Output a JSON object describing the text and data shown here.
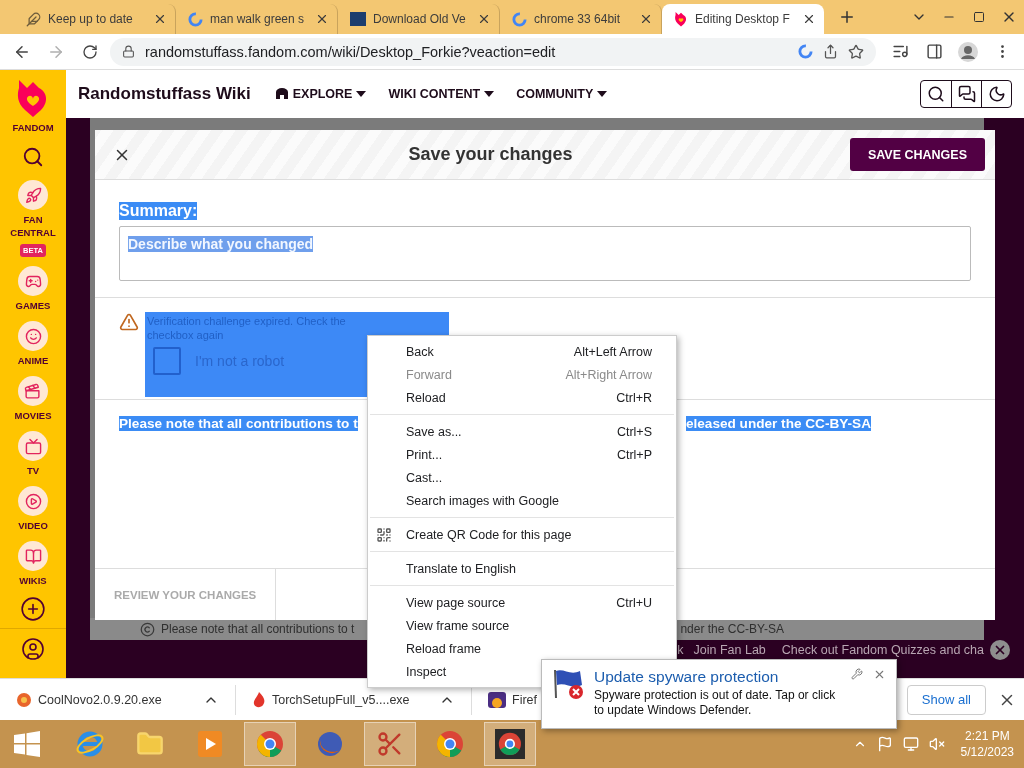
{
  "browser": {
    "tabs": [
      {
        "title": "Keep up to date",
        "kind": "feather",
        "selected": false
      },
      {
        "title": "man walk green s",
        "kind": "google",
        "selected": false
      },
      {
        "title": "Download Old Ve",
        "kind": "square",
        "selected": false
      },
      {
        "title": "chrome 33 64bit",
        "kind": "google",
        "selected": false
      },
      {
        "title": "Editing Desktop F",
        "kind": "fandom",
        "selected": true
      }
    ],
    "forward_disabled": true,
    "address": "randomstuffass.fandom.com/wiki/Desktop_Forkie?veaction=edit"
  },
  "rail": {
    "logo_label": "FANDOM",
    "items": [
      {
        "kind": "rocket",
        "label": "FAN CENTRAL",
        "badge": "BETA"
      },
      {
        "kind": "gamepad",
        "label": "GAMES"
      },
      {
        "kind": "face",
        "label": "ANIME"
      },
      {
        "kind": "clapper",
        "label": "MOVIES"
      },
      {
        "kind": "tv",
        "label": "TV"
      },
      {
        "kind": "play",
        "label": "VIDEO"
      },
      {
        "kind": "book",
        "label": "WIKIS"
      }
    ]
  },
  "wiki_nav": {
    "title": "Randomstuffass Wiki",
    "menus": [
      "EXPLORE",
      "WIKI CONTENT",
      "COMMUNITY"
    ]
  },
  "background_page": {
    "license_left": "Please note that all contributions to t",
    "license_right": "nder the CC-BY-SA",
    "footer_links": [
      "k",
      "Join Fan Lab",
      "Check out Fandom Quizzes and cha"
    ]
  },
  "dialog": {
    "title": "Save your changes",
    "save_button": "SAVE CHANGES",
    "highlighted": true,
    "summary_label": "Summary:",
    "summary_placeholder": "Describe what you changed",
    "captcha": {
      "message": "Verification challenge expired. Check the checkbox again",
      "checkbox_label": "I'm not a robot",
      "checked": false
    },
    "note_left": "Please note that all contributions to t",
    "note_right": "eleased under the CC-BY-SA",
    "review_button": "REVIEW YOUR CHANGES"
  },
  "context_menu": {
    "groups": [
      [
        {
          "label": "Back",
          "shortcut": "Alt+Left Arrow",
          "disabled": false
        },
        {
          "label": "Forward",
          "shortcut": "Alt+Right Arrow",
          "disabled": true
        },
        {
          "label": "Reload",
          "shortcut": "Ctrl+R",
          "disabled": false
        }
      ],
      [
        {
          "label": "Save as...",
          "shortcut": "Ctrl+S",
          "disabled": false
        },
        {
          "label": "Print...",
          "shortcut": "Ctrl+P",
          "disabled": false
        },
        {
          "label": "Cast...",
          "disabled": false
        },
        {
          "label": "Search images with Google",
          "disabled": false
        }
      ],
      [
        {
          "label": "Create QR Code for this page",
          "kind": "qr",
          "disabled": false
        }
      ],
      [
        {
          "label": "Translate to English",
          "disabled": false
        }
      ],
      [
        {
          "label": "View page source",
          "shortcut": "Ctrl+U",
          "disabled": false
        },
        {
          "label": "View frame source",
          "disabled": false
        },
        {
          "label": "Reload frame",
          "disabled": false
        },
        {
          "label": "Inspect",
          "disabled": false
        }
      ]
    ]
  },
  "downloads": {
    "items": [
      {
        "name": "CoolNovo2.0.9.20.exe",
        "kind": "coolnovo"
      },
      {
        "name": "TorchSetupFull_v5....exe",
        "kind": "torch"
      },
      {
        "name": "Firef",
        "kind": "firefox"
      }
    ],
    "show_all": "Show all"
  },
  "notification": {
    "title": "Update spyware protection",
    "body": "Spyware protection is out of date. Tap or click to update Windows Defender."
  },
  "taskbar": {
    "apps": [
      {
        "kind": "ie",
        "running": false
      },
      {
        "kind": "folder",
        "running": false
      },
      {
        "kind": "media",
        "running": false
      },
      {
        "kind": "chrome",
        "running": true
      },
      {
        "kind": "firefox",
        "running": false
      },
      {
        "kind": "scissors",
        "running": true
      },
      {
        "kind": "chrome",
        "running": false
      },
      {
        "kind": "chromedark",
        "running": true
      }
    ],
    "time": "2:21 PM",
    "date": "5/12/2023"
  }
}
